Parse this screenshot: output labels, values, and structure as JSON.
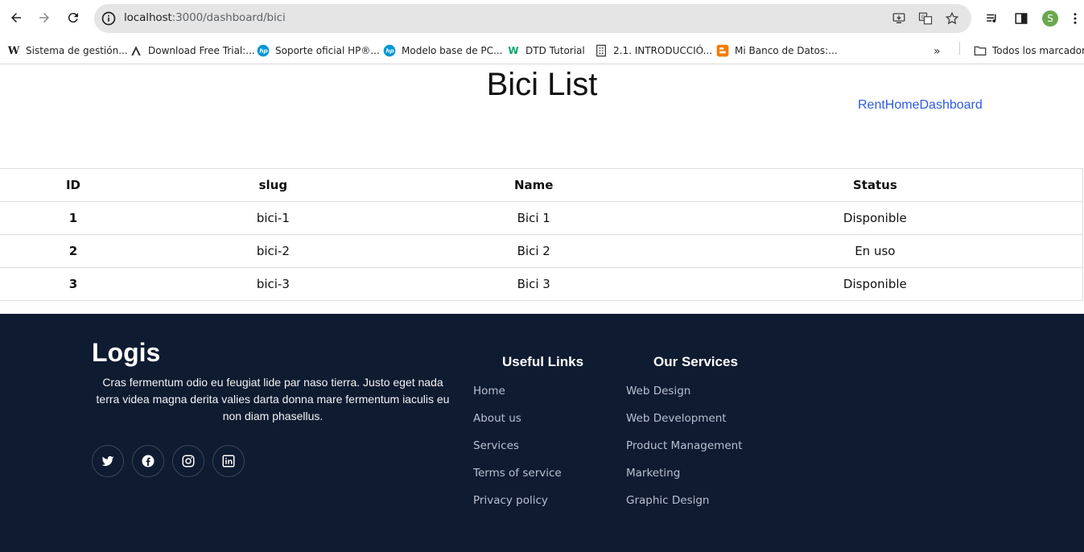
{
  "browser": {
    "url_host": "localhost",
    "url_rest": ":3000/dashboard/bici",
    "profile_initial": "S",
    "bookmarks": [
      {
        "label": "Sistema de gestión...",
        "icon": "wikipedia-icon"
      },
      {
        "label": "Download Free Trial:...",
        "icon": "autodesk-icon"
      },
      {
        "label": "Soporte oficial HP®...",
        "icon": "hp-icon"
      },
      {
        "label": "Modelo base de PC...",
        "icon": "hp-icon"
      },
      {
        "label": "DTD Tutorial",
        "icon": "w3schools-icon"
      },
      {
        "label": "2.1. INTRODUCCIÓ...",
        "icon": "building-icon"
      },
      {
        "label": "Mi Banco de Datos:...",
        "icon": "blogger-icon"
      }
    ],
    "all_bookmarks_label": "Todos los marcadores"
  },
  "page": {
    "title": "Bici List",
    "nav": [
      "Rent",
      "Home",
      "Dashboard"
    ]
  },
  "table": {
    "headers": [
      "ID",
      "slug",
      "Name",
      "Status"
    ],
    "rows": [
      [
        "1",
        "bici-1",
        "Bici 1",
        "Disponible"
      ],
      [
        "2",
        "bici-2",
        "Bici 2",
        "En uso"
      ],
      [
        "3",
        "bici-3",
        "Bici 3",
        "Disponible"
      ]
    ]
  },
  "footer": {
    "brand": "Logis",
    "about": "Cras fermentum odio eu feugiat lide par naso tierra. Justo eget nada terra videa magna derita valies darta donna mare fermentum iaculis eu non diam phasellus.",
    "social": [
      "twitter-icon",
      "facebook-icon",
      "instagram-icon",
      "linkedin-icon"
    ],
    "useful_links_title": "Useful Links",
    "useful_links": [
      "Home",
      "About us",
      "Services",
      "Terms of service",
      "Privacy policy"
    ],
    "services_title": "Our Services",
    "services": [
      "Web Design",
      "Web Development",
      "Product Management",
      "Marketing",
      "Graphic Design"
    ]
  },
  "colors": {
    "footer_bg": "#0f1b31",
    "link_blue": "#2d5be3",
    "footer_link": "#b7c0cf"
  }
}
